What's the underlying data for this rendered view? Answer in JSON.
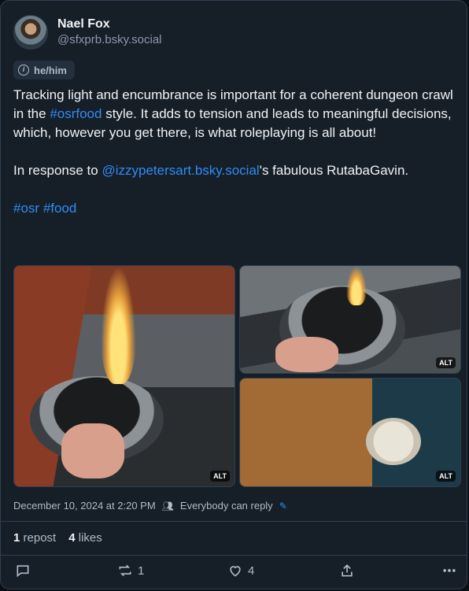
{
  "author": {
    "display_name": "Nael Fox",
    "handle": "@sfxprb.bsky.social",
    "pronouns": "he/him"
  },
  "post": {
    "p1_a": "Tracking light and encumbrance is important for a coherent dungeon crawl in the ",
    "p1_link": "#osrfood",
    "p1_b": " style. It adds to tension and leads to meaningful decisions, which, however you get there, is what roleplaying is all about!",
    "p2_a": "In response to ",
    "p2_link": "@izzypetersart.bsky.social",
    "p2_b": "'s fabulous RutabaGavin.",
    "tag1": "#osr",
    "tag2": "#food"
  },
  "media": {
    "alt_label": "ALT"
  },
  "meta": {
    "timestamp": "December 10, 2024 at 2:20 PM",
    "reply_setting": "Everybody can reply"
  },
  "stats": {
    "reposts_count": "1",
    "reposts_label": "repost",
    "likes_count": "4",
    "likes_label": "likes"
  },
  "actions": {
    "repost_count": "1",
    "like_count": "4"
  },
  "colors": {
    "link": "#2f8df5",
    "background": "#161e27",
    "border": "#2e4052"
  }
}
